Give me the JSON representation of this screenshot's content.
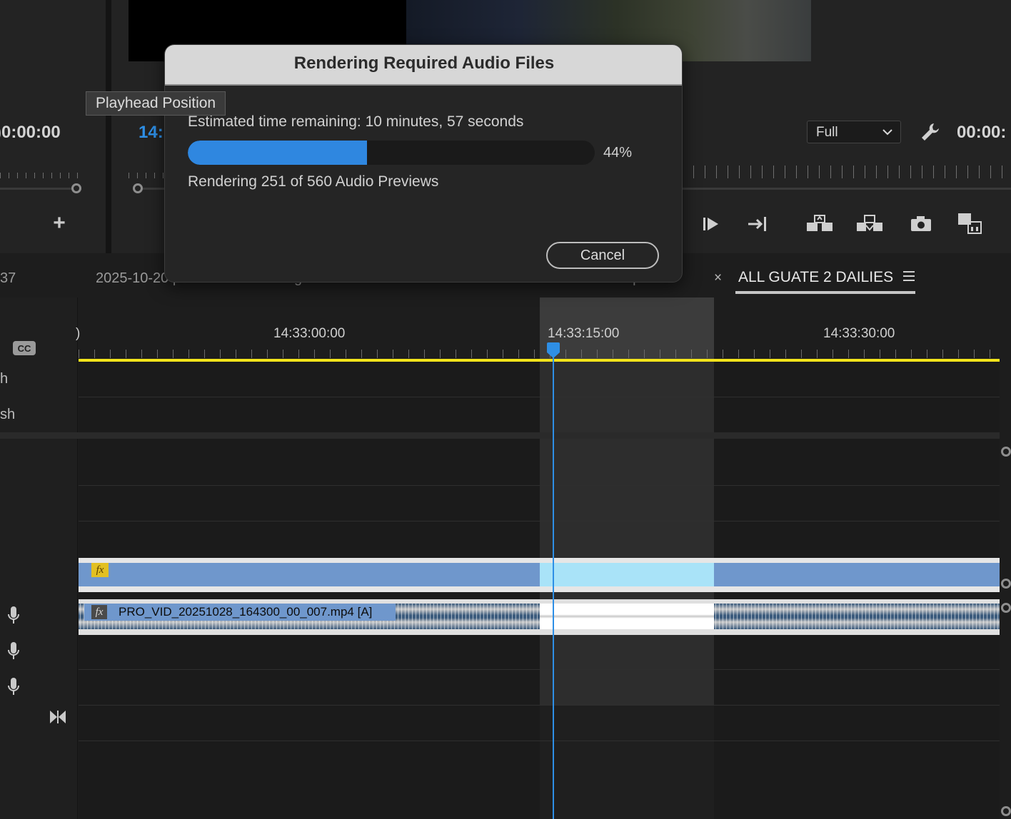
{
  "tooltip": {
    "text": "Playhead Position"
  },
  "source_monitor": {
    "timecode": ")0:00:00"
  },
  "program_monitor": {
    "timecode_partial": "14:",
    "timecode_right": "00:00:",
    "quality": {
      "selected": "Full",
      "options": [
        "Full"
      ]
    }
  },
  "tabs": {
    "left_fragment": "37",
    "sequence_1": "2025-10-20 perros libres feeding reel #1 - Version 2",
    "sequence_2": "2025-10-20 Felipe",
    "close_glyph": "×",
    "active": "ALL GUATE 2 DAILIES"
  },
  "timeline": {
    "ruler_labels": [
      ")",
      "14:33:00:00",
      "14:33:15:00",
      "14:33:30:00"
    ],
    "track_labels": [
      "h",
      "sh"
    ],
    "audio_clip_name": "PRO_VID_20251028_164300_00_007.mp4 [A]",
    "fx_label": "fx"
  },
  "dialog": {
    "title": "Rendering Required Audio Files",
    "time_remaining": "Estimated time remaining: 10 minutes, 57 seconds",
    "progress_percent": "44%",
    "progress_value": 0.44,
    "status": "Rendering 251 of 560 Audio Previews",
    "cancel_label": "Cancel"
  },
  "colors": {
    "accent_blue": "#2e8fe6",
    "render_bar_yellow": "#f2e31b",
    "clip_blue": "#6f97cc",
    "clip_selected": "#a9e3f8"
  },
  "icons": [
    "plus-icon",
    "wrench-icon",
    "play-to-out-icon",
    "step-forward-icon",
    "lift-icon",
    "extract-icon",
    "camera-icon",
    "compare-icon",
    "cc-icon",
    "menu-icon",
    "mic-icon",
    "bowtie-icon",
    "playhead-icon",
    "chevron-down-icon"
  ]
}
